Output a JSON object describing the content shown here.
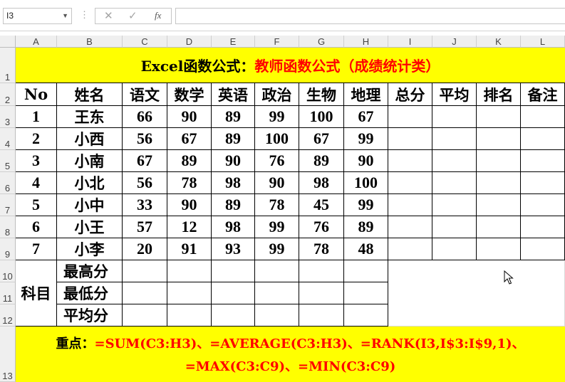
{
  "formula_bar": {
    "name_box": "I3",
    "separator": "⋮",
    "cancel_icon": "✕",
    "enter_icon": "✓",
    "fx_label": "fx",
    "formula": ""
  },
  "columns": [
    "A",
    "B",
    "C",
    "D",
    "E",
    "F",
    "G",
    "H",
    "I",
    "J",
    "K",
    "L"
  ],
  "rows": [
    "1",
    "2",
    "3",
    "4",
    "5",
    "6",
    "7",
    "8",
    "9",
    "10",
    "11",
    "12",
    "13"
  ],
  "title": {
    "prefix": "Excel函数公式：",
    "main": "教师函数公式（成绩统计类）"
  },
  "table": {
    "headers": [
      "No",
      "姓名",
      "语文",
      "数学",
      "英语",
      "政治",
      "生物",
      "地理",
      "总分",
      "平均",
      "排名",
      "备注"
    ],
    "students": [
      {
        "no": "1",
        "name": "王东",
        "scores": [
          "66",
          "90",
          "89",
          "99",
          "100",
          "67"
        ]
      },
      {
        "no": "2",
        "name": "小西",
        "scores": [
          "56",
          "67",
          "89",
          "100",
          "67",
          "99"
        ]
      },
      {
        "no": "3",
        "name": "小南",
        "scores": [
          "67",
          "89",
          "90",
          "76",
          "89",
          "90"
        ]
      },
      {
        "no": "4",
        "name": "小北",
        "scores": [
          "56",
          "78",
          "98",
          "90",
          "98",
          "100"
        ]
      },
      {
        "no": "5",
        "name": "小中",
        "scores": [
          "33",
          "90",
          "89",
          "78",
          "45",
          "99"
        ]
      },
      {
        "no": "6",
        "name": "小王",
        "scores": [
          "57",
          "12",
          "98",
          "99",
          "76",
          "89"
        ]
      },
      {
        "no": "7",
        "name": "小李",
        "scores": [
          "20",
          "91",
          "93",
          "99",
          "78",
          "48"
        ]
      }
    ],
    "subject_label": "科目",
    "stat_labels": [
      "最高分",
      "最低分",
      "平均分"
    ]
  },
  "note": {
    "prefix": "重点：",
    "line1": "=SUM(C3:H3)、=AVERAGE(C3:H3)、=RANK(I3,I$3:I$9,1)、",
    "line2": "=MAX(C3:C9)、=MIN(C3:C9)"
  },
  "colors": {
    "highlight": "#ffff00",
    "formula_red": "#ff0000"
  }
}
